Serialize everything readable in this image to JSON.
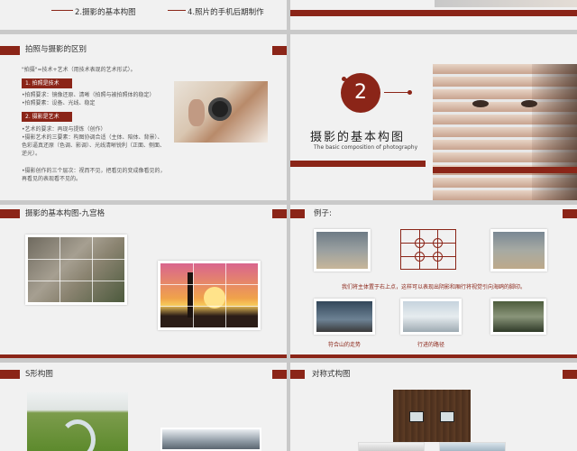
{
  "colors": {
    "accent": "#8b2518",
    "bg": "#f1f1f1"
  },
  "s1": {
    "item2": "2.摄影的基本构图",
    "item4": "4.照片的手机后期制作"
  },
  "s3": {
    "title": "拍照与摄影的区别",
    "def": "\"拍摄\"=技术+艺术（用技术表现的艺术形式）。",
    "tag1": "1. 拍照是技术",
    "l1": "•拍照要求：镜像还原、清晰（拍照与被拍照体的稳定）",
    "l2": "•拍照要素：设备、光线、稳定",
    "tag2": "2. 摄影是艺术",
    "l3": "•艺术的要求：再现与提炼（创作）",
    "l4": "•摄影艺术的三要素：构图协调合适（主体、陪体、背景）、色彩逼真还原（色调、影调）、光线清晰锐利（正面、侧面、逆光）。",
    "l5": "•摄影创作的三个层次：视而不见，把看见的变成像看见的，再看见的表现看不见的。"
  },
  "s4": {
    "num": "2",
    "title": "摄影的基本构图",
    "subtitle": "The basic composition of photography"
  },
  "s5": {
    "title": "摄影的基本构图-九宫格"
  },
  "s6": {
    "title": "例子:",
    "caption": "我们将主体置于右上点，这样可以表现出阴影和厢行将视觉引向海鸥的脚印。",
    "cap1": "符合山的走势",
    "cap2": "行进的路径"
  },
  "s7": {
    "title": "S形构图"
  },
  "s8": {
    "title": "对称式构图"
  }
}
